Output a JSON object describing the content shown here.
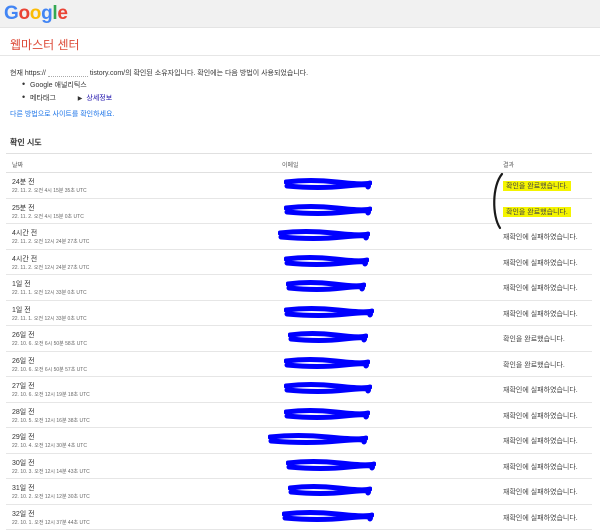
{
  "header": {
    "logo": {
      "letters": [
        "G",
        "o",
        "o",
        "g",
        "l",
        "e"
      ],
      "colors": [
        "#4285F4",
        "#EA4335",
        "#FBBC05",
        "#4285F4",
        "#34A853",
        "#EA4335"
      ]
    }
  },
  "page_title": "웹마스터 센터",
  "owner": {
    "prefix": "현재 https://",
    "suffix": "tistory.com/의 확인된 소유자입니다. 확인에는 다음 방법이 사용되었습니다."
  },
  "methods": [
    {
      "label": "Google 애널리틱스"
    },
    {
      "label": "메타태그",
      "more": "상세정보"
    }
  ],
  "other_methods_link": "다른 방법으로 사이트를 확인하세요.",
  "attempts": {
    "heading": "확인 시도",
    "columns": {
      "date": "날짜",
      "email": "이메일",
      "result": "결과"
    },
    "rows": [
      {
        "relative": "24분 전",
        "absolute": "22. 11. 2. 오전 4시 15분 35초 UTC",
        "result": "확인을 완료했습니다.",
        "highlight": true
      },
      {
        "relative": "25분 전",
        "absolute": "22. 11. 2. 오전 4시 15분 0초 UTC",
        "result": "확인을 완료했습니다.",
        "highlight": true
      },
      {
        "relative": "4시간 전",
        "absolute": "22. 11. 2. 오전 12시 24분 27초 UTC",
        "result": "재확인에 실패하였습니다.",
        "highlight": false
      },
      {
        "relative": "4시간 전",
        "absolute": "22. 11. 2. 오전 12시 24분 27초 UTC",
        "result": "재확인에 실패하였습니다.",
        "highlight": false
      },
      {
        "relative": "1일 전",
        "absolute": "22. 11. 1. 오전 12시 33분 0초 UTC",
        "result": "재확인에 실패하였습니다.",
        "highlight": false
      },
      {
        "relative": "1일 전",
        "absolute": "22. 11. 1. 오전 12시 33분 0초 UTC",
        "result": "재확인에 실패하였습니다.",
        "highlight": false
      },
      {
        "relative": "26일 전",
        "absolute": "22. 10. 6. 오전 6시 50분 58초 UTC",
        "result": "확인을 완료했습니다.",
        "highlight": false
      },
      {
        "relative": "26일 전",
        "absolute": "22. 10. 6. 오전 6시 50분 57초 UTC",
        "result": "확인을 완료했습니다.",
        "highlight": false
      },
      {
        "relative": "27일 전",
        "absolute": "22. 10. 6. 오전 12시 19분 18초 UTC",
        "result": "재확인에 실패하였습니다.",
        "highlight": false
      },
      {
        "relative": "28일 전",
        "absolute": "22. 10. 5. 오전 12시 16분 38초 UTC",
        "result": "재확인에 실패하였습니다.",
        "highlight": false
      },
      {
        "relative": "29일 전",
        "absolute": "22. 10. 4. 오전 12시 30분 4초 UTC",
        "result": "재확인에 실패하였습니다.",
        "highlight": false
      },
      {
        "relative": "30일 전",
        "absolute": "22. 10. 3. 오전 12시 14분 43초 UTC",
        "result": "재확인에 실패하였습니다.",
        "highlight": false
      },
      {
        "relative": "31일 전",
        "absolute": "22. 10. 2. 오전 12시 12분 30초 UTC",
        "result": "재확인에 실패하였습니다.",
        "highlight": false
      },
      {
        "relative": "32일 전",
        "absolute": "22. 10. 1. 오전 12시 37분 44초 UTC",
        "result": "재확인에 실패하였습니다.",
        "highlight": false
      }
    ]
  },
  "annotation_colors": {
    "redaction": "#0000ff",
    "highlight": "#f4f400",
    "bracket": "#1a1a1a"
  }
}
